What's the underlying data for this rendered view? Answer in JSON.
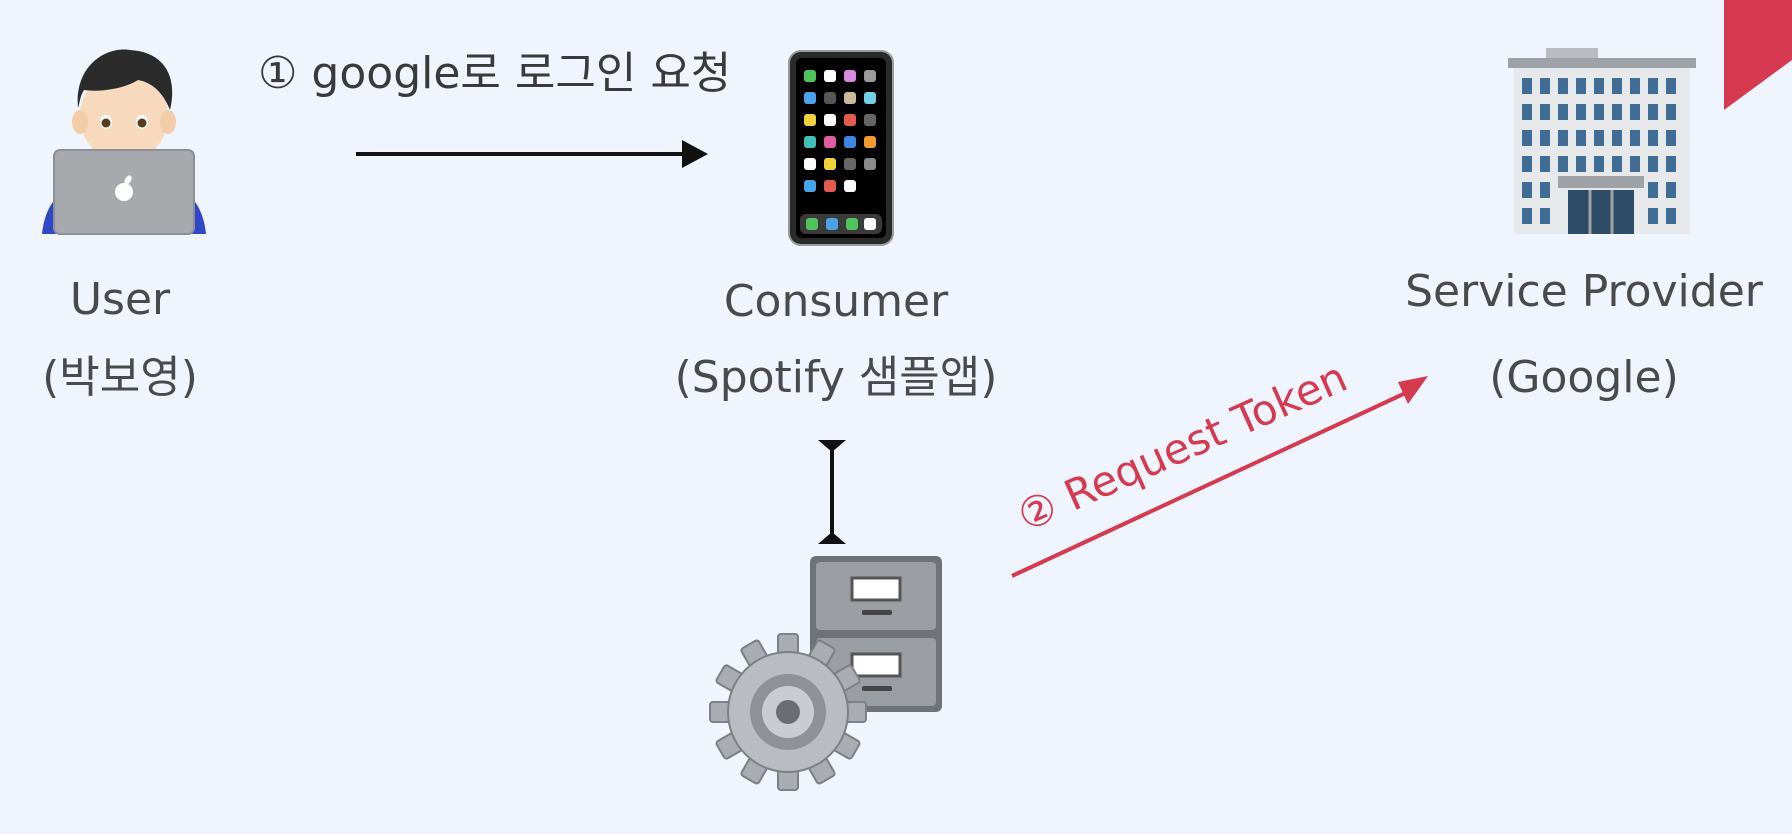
{
  "user": {
    "name": "User",
    "sub": "(박보영)"
  },
  "consumer": {
    "name": "Consumer",
    "sub": "(Spotify 샘플앱)"
  },
  "provider": {
    "name": "Service Provider",
    "sub": "(Google)"
  },
  "steps": {
    "step1": "① google로 로그인 요청",
    "step2": "② Request Token"
  },
  "icons": {
    "user": "person-at-laptop-icon",
    "consumer": "mobile-phone-icon",
    "provider": "office-building-icon",
    "storage": "file-cabinet-gear-icon"
  },
  "colors": {
    "background": "#eff4fd",
    "accent": "#d63a50",
    "text": "#4a4a4a"
  }
}
